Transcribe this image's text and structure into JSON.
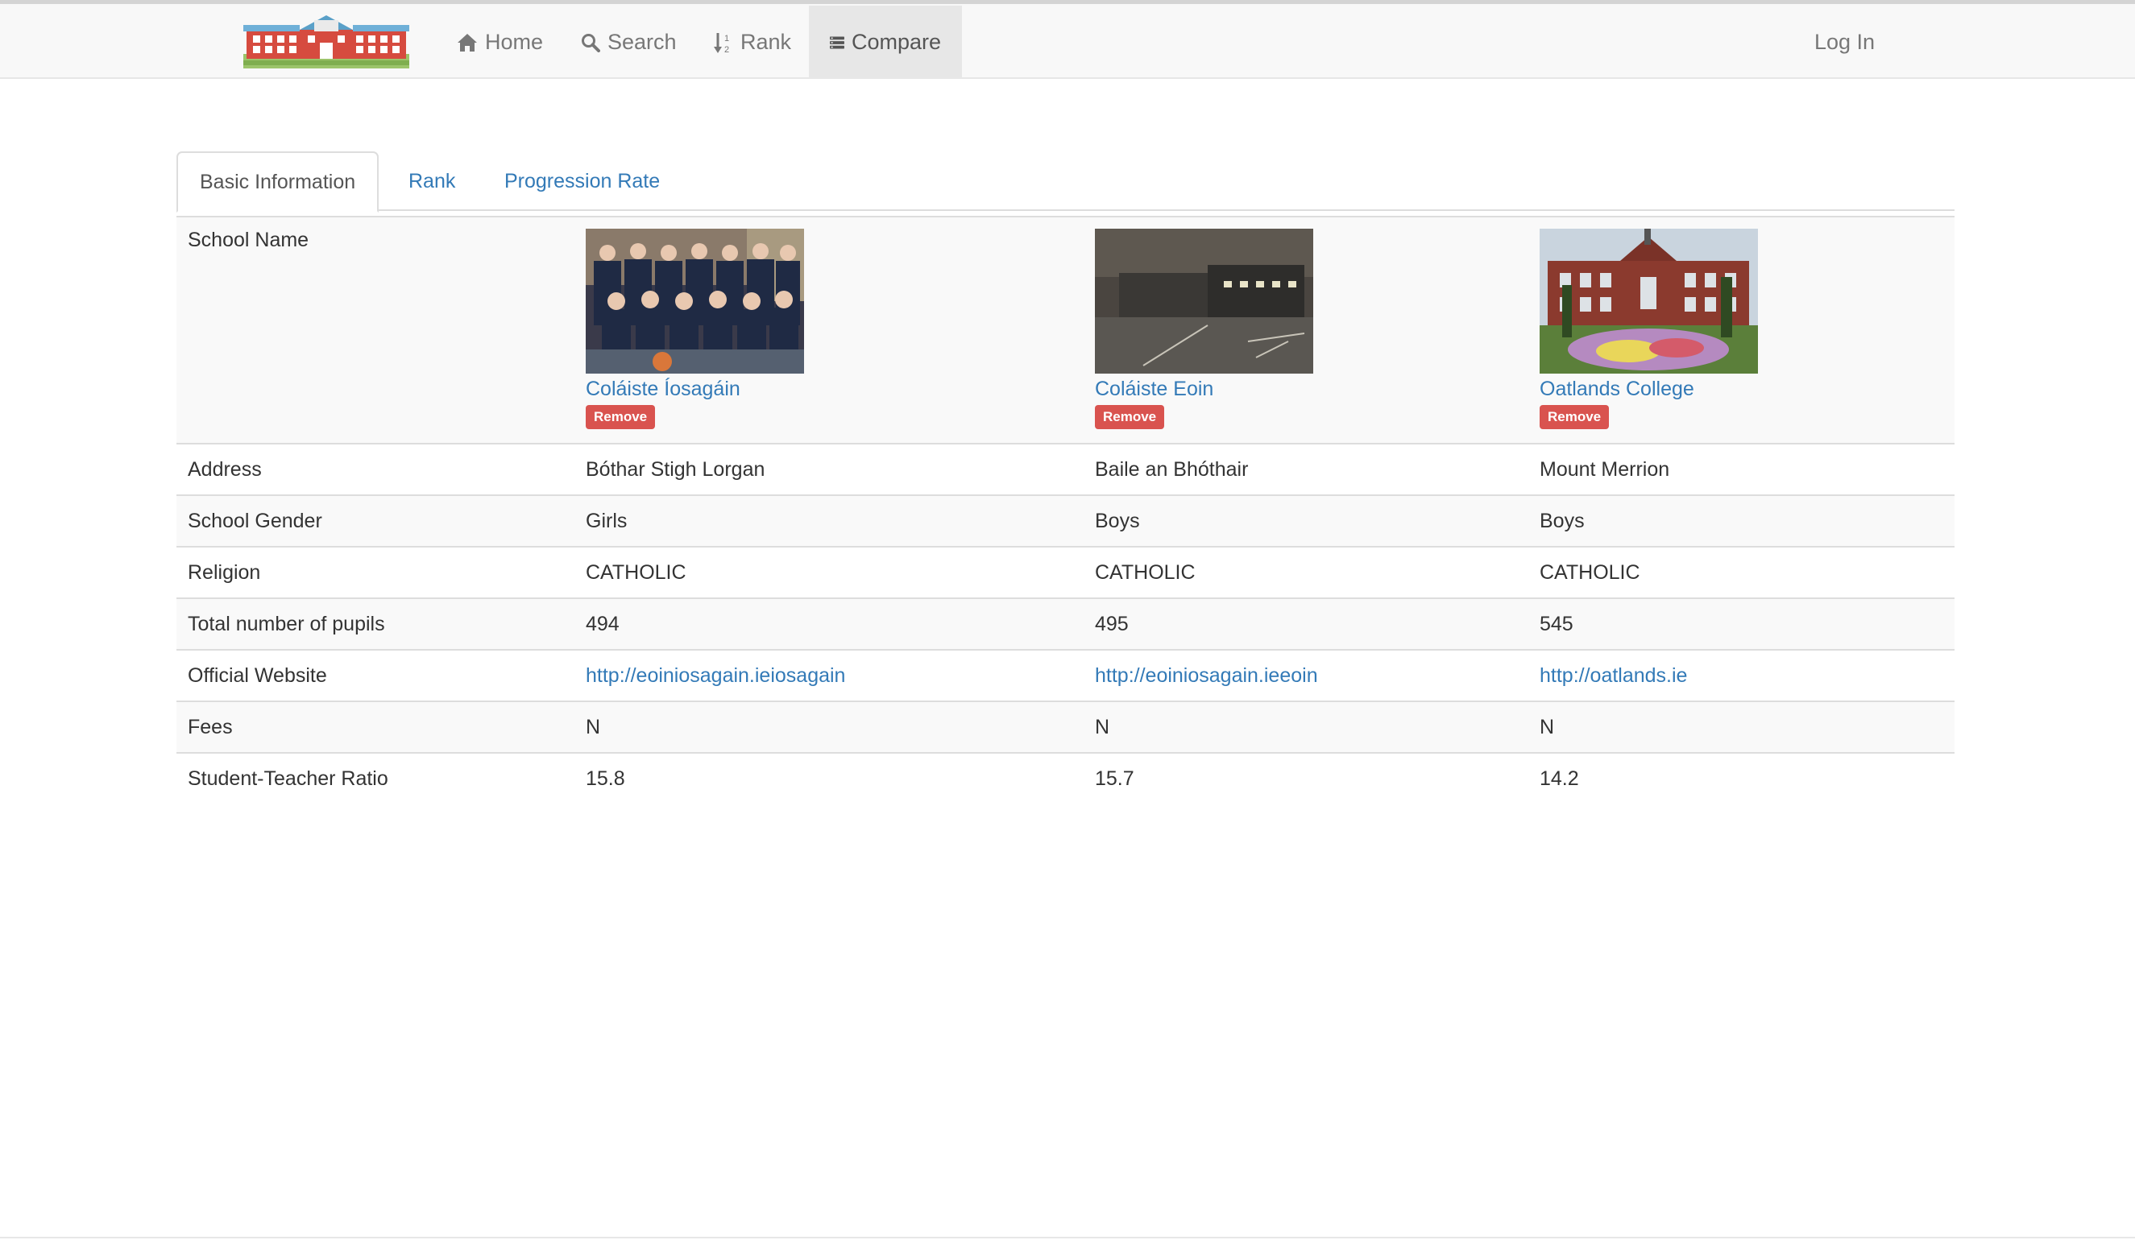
{
  "nav": {
    "home": "Home",
    "search": "Search",
    "rank": "Rank",
    "compare": "Compare",
    "login": "Log In"
  },
  "tabs": [
    {
      "label": "Basic Information"
    },
    {
      "label": "Rank"
    },
    {
      "label": "Progression Rate"
    }
  ],
  "table": {
    "labels": {
      "school_name": "School Name",
      "address": "Address",
      "gender": "School Gender",
      "religion": "Religion",
      "pupils": "Total number of pupils",
      "website": "Official Website",
      "fees": "Fees",
      "ratio": "Student-Teacher Ratio"
    },
    "remove_label": "Remove",
    "schools": [
      {
        "name": "Coláiste Íosagáin",
        "address": "Bóthar Stigh Lorgan",
        "gender": "Girls",
        "religion": "CATHOLIC",
        "pupils": "494",
        "website": "http://eoiniosagain.ieiosagain",
        "fees": "N",
        "ratio": "15.8"
      },
      {
        "name": "Coláiste Eoin",
        "address": "Baile an Bhóthair",
        "gender": "Boys",
        "religion": "CATHOLIC",
        "pupils": "495",
        "website": "http://eoiniosagain.ieeoin",
        "fees": "N",
        "ratio": "15.7"
      },
      {
        "name": "Oatlands College",
        "address": "Mount Merrion",
        "gender": "Boys",
        "religion": "CATHOLIC",
        "pupils": "545",
        "website": "http://oatlands.ie",
        "fees": "N",
        "ratio": "14.2"
      }
    ]
  },
  "colors": {
    "link": "#337ab7",
    "remove": "#d9534f",
    "navbar_bg": "#f8f8f8"
  }
}
